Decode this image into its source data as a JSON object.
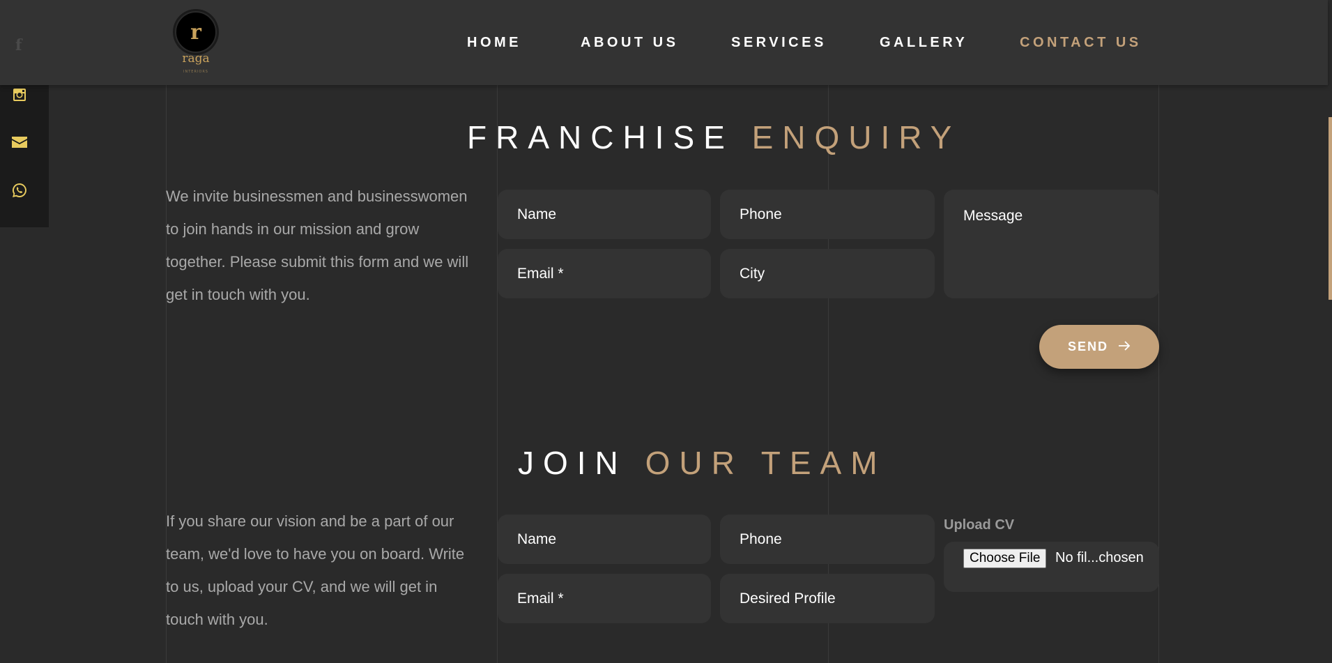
{
  "header": {
    "nav": [
      {
        "label": "HOME"
      },
      {
        "label": "ABOUT US"
      },
      {
        "label": "SERVICES"
      },
      {
        "label": "GALLERY"
      },
      {
        "label": "CONTACT US"
      }
    ],
    "logo": {
      "mark": "r",
      "name": "raga",
      "sub": "INTERIORS"
    },
    "facebook_glyph": "f"
  },
  "social": [
    {
      "icon": "instagram-icon"
    },
    {
      "icon": "email-icon"
    },
    {
      "icon": "whatsapp-icon"
    }
  ],
  "franchise": {
    "title_white": "FRANCHISE",
    "title_gold": "ENQUIRY",
    "description": "We invite businessmen and businesswomen to join hands in our mission and grow together. Please submit this form and we will get in touch with you.",
    "fields": {
      "name": "Name",
      "phone": "Phone",
      "message": "Message",
      "email": "Email *",
      "city": "City"
    },
    "send_label": "SEND"
  },
  "team": {
    "title_white": "JOIN",
    "title_gold": "OUR TEAM",
    "description": "If you share our vision and be a part of our team, we'd love to have you on board. Write to us, upload your CV, and we will get in touch with you.",
    "fields": {
      "name": "Name",
      "phone": "Phone",
      "email": "Email *",
      "desired_profile": "Desired Profile"
    },
    "upload_label": "Upload CV",
    "choose_file": "Choose File",
    "no_file": "No fil...chosen"
  },
  "colors": {
    "accent": "#c3a17a",
    "icon": "#e8cb5e",
    "bg": "#2a2a2a",
    "field": "#333333"
  }
}
